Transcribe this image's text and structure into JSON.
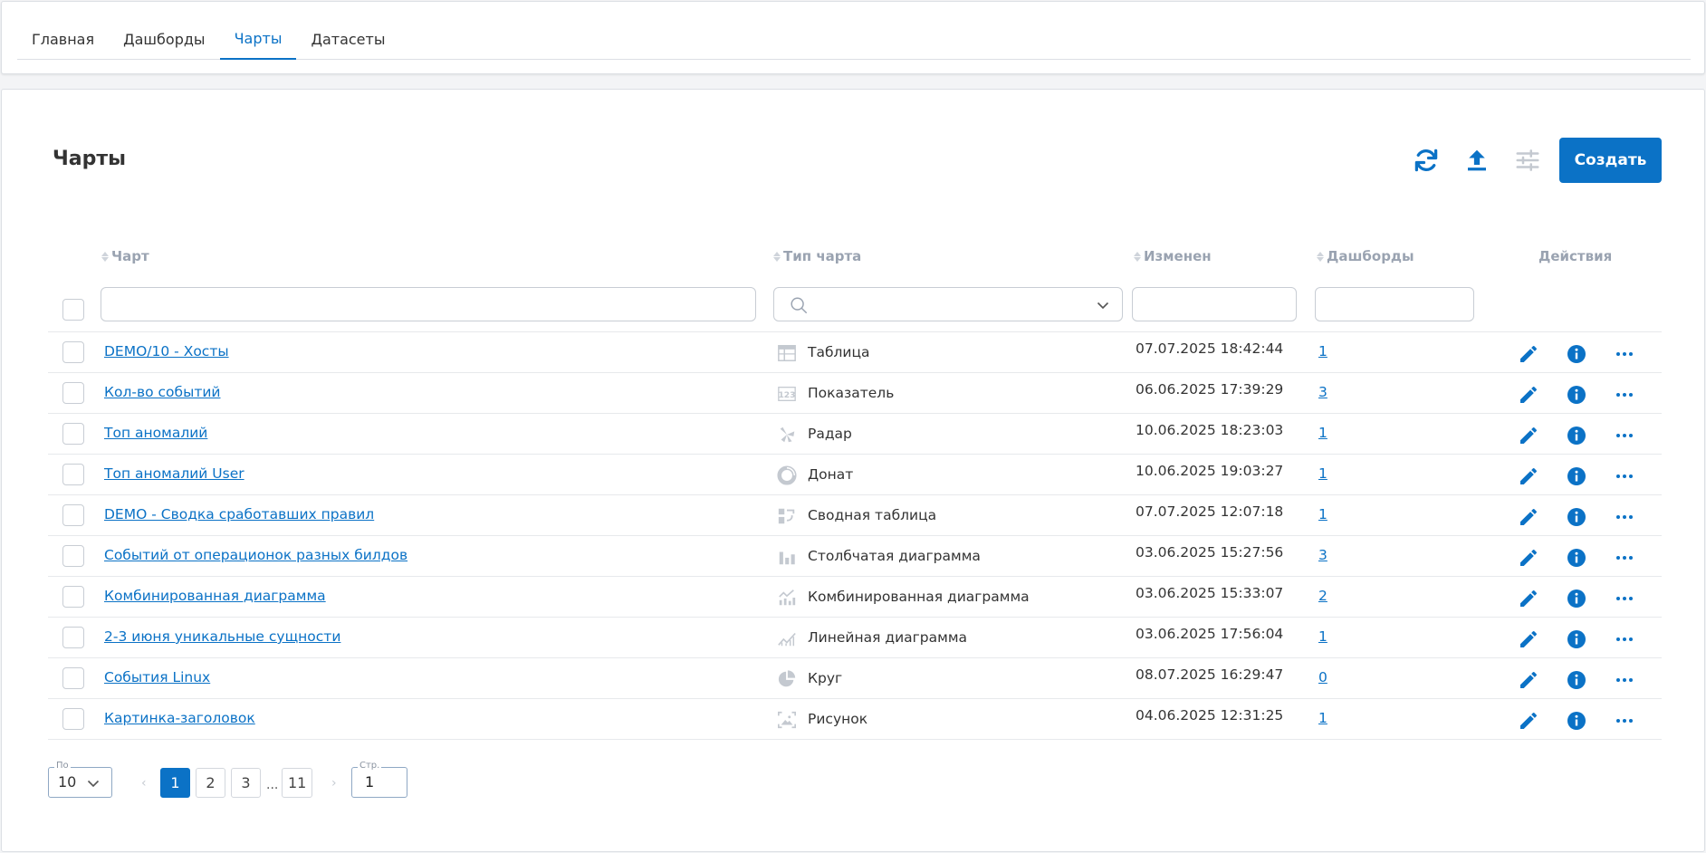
{
  "nav": {
    "tabs": [
      {
        "label": "Главная"
      },
      {
        "label": "Дашборды"
      },
      {
        "label": "Чарты"
      },
      {
        "label": "Датасеты"
      }
    ],
    "active_tab": "Чарты"
  },
  "page": {
    "title": "Чарты",
    "create_label": "Создать"
  },
  "table": {
    "columns": {
      "chart": "Чарт",
      "type": "Тип чарта",
      "modified": "Изменен",
      "dashboards": "Дашборды",
      "actions": "Действия"
    },
    "rows": [
      {
        "name": "DEMO/10 - Хосты",
        "type": "Таблица",
        "type_icon": "table-icon",
        "modified": "07.07.2025 18:42:44",
        "dashboards": "1"
      },
      {
        "name": "Кол-во событий",
        "type": "Показатель",
        "type_icon": "number-icon",
        "modified": "06.06.2025 17:39:29",
        "dashboards": "3"
      },
      {
        "name": "Топ аномалий",
        "type": "Радар",
        "type_icon": "radar-icon",
        "modified": "10.06.2025 18:23:03",
        "dashboards": "1"
      },
      {
        "name": "Топ аномалий User",
        "type": "Донат",
        "type_icon": "donut-icon",
        "modified": "10.06.2025 19:03:27",
        "dashboards": "1"
      },
      {
        "name": "DEMO - Сводка сработавших правил",
        "type": "Сводная таблица",
        "type_icon": "pivot-table-icon",
        "modified": "07.07.2025 12:07:18",
        "dashboards": "1"
      },
      {
        "name": "Событий от операционок разных билдов",
        "type": "Столбчатая диаграмма",
        "type_icon": "bar-chart-icon",
        "modified": "03.06.2025 15:27:56",
        "dashboards": "3"
      },
      {
        "name": "Комбинированная диаграмма",
        "type": "Комбинированная диаграмма",
        "type_icon": "combo-chart-icon",
        "modified": "03.06.2025 15:33:07",
        "dashboards": "2"
      },
      {
        "name": "2-3 июня уникальные сущности",
        "type": "Линейная диаграмма",
        "type_icon": "line-chart-icon",
        "modified": "03.06.2025 17:56:04",
        "dashboards": "1"
      },
      {
        "name": "События Linux",
        "type": "Круг",
        "type_icon": "pie-chart-icon",
        "modified": "08.07.2025 16:29:47",
        "dashboards": "0"
      },
      {
        "name": "Картинка-заголовок",
        "type": "Рисунок",
        "type_icon": "image-icon",
        "modified": "04.06.2025 12:31:25",
        "dashboards": "1"
      }
    ]
  },
  "pagination": {
    "per_page_label": "По",
    "per_page_value": "10",
    "pages": [
      "1",
      "2",
      "3",
      "11"
    ],
    "ellipsis": "...",
    "current": "1",
    "goto_label": "Стр.",
    "goto_value": "1"
  },
  "colors": {
    "accent": "#0b72c6",
    "icon_gray": "#c4c9d0"
  }
}
